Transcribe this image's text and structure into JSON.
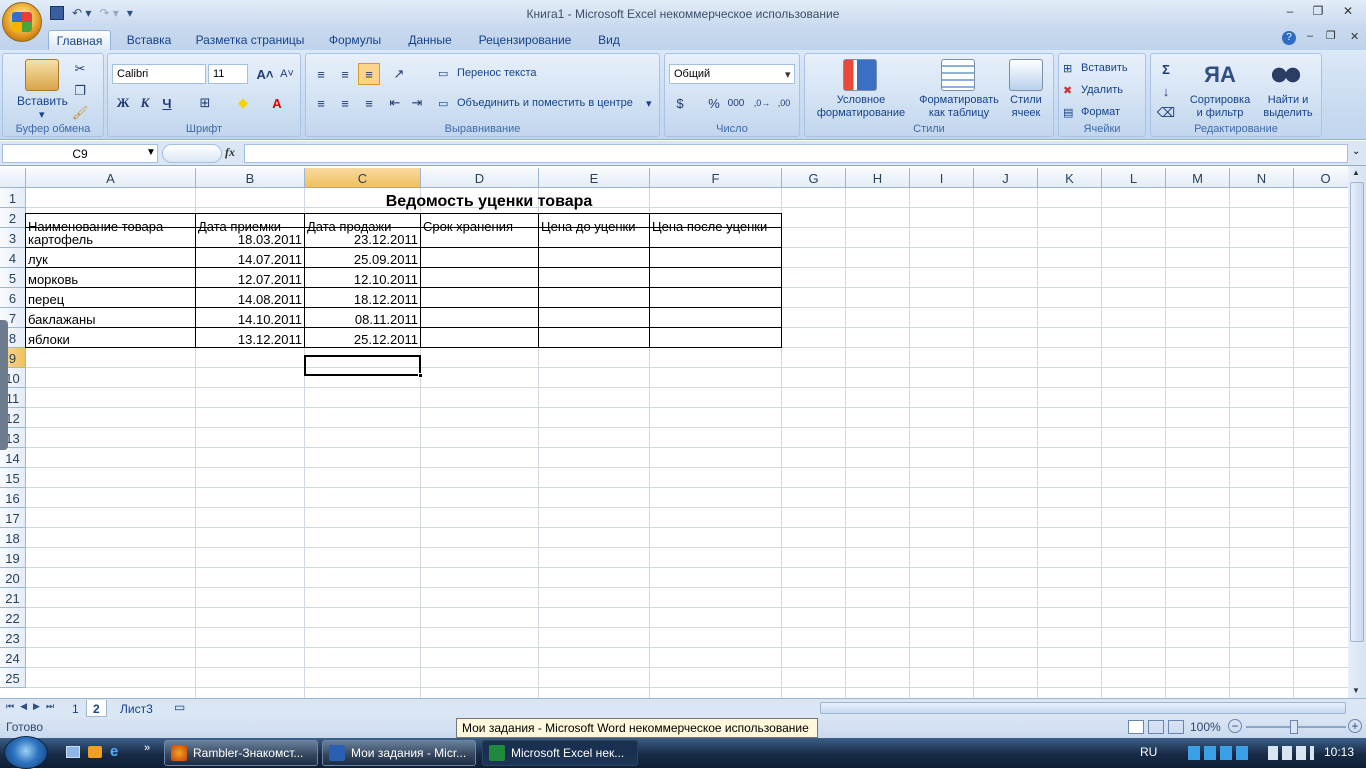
{
  "window": {
    "title": "Книга1  -  Microsoft Excel некоммерческое использование",
    "minimize": "–",
    "restore": "❐",
    "close": "✕"
  },
  "ribbon": {
    "tabs": [
      "Главная",
      "Вставка",
      "Разметка страницы",
      "Формулы",
      "Данные",
      "Рецензирование",
      "Вид"
    ],
    "active_tab": "Главная",
    "clipboard": {
      "paste": "Вставить",
      "group": "Буфер обмена"
    },
    "font": {
      "name": "Calibri",
      "size": "11",
      "group": "Шрифт",
      "bold": "Ж",
      "italic": "К",
      "underline": "Ч"
    },
    "alignment": {
      "wrap": "Перенос текста",
      "merge": "Объединить и поместить в центре",
      "group": "Выравнивание"
    },
    "number": {
      "format": "Общий",
      "percent": "%",
      "thousands": "000",
      "group": "Число"
    },
    "styles": {
      "conditional": "Условное\nформатирование",
      "table": "Форматировать\nкак таблицу",
      "cell": "Стили\nячеек",
      "group": "Стили"
    },
    "cells": {
      "insert": "Вставить",
      "delete": "Удалить",
      "format": "Формат",
      "group": "Ячейки"
    },
    "editing": {
      "sort": "Сортировка\nи фильтр",
      "find": "Найти и\nвыделить",
      "group": "Редактирование"
    }
  },
  "formula_bar": {
    "name_box": "C9",
    "fx": "fx",
    "value": ""
  },
  "sheet": {
    "columns": [
      "A",
      "B",
      "C",
      "D",
      "E",
      "F",
      "G",
      "H",
      "I",
      "J",
      "K",
      "L",
      "M",
      "N",
      "O"
    ],
    "rows": [
      "1",
      "2",
      "3",
      "4",
      "5",
      "6",
      "7",
      "8",
      "9",
      "10",
      "11",
      "12",
      "13",
      "14",
      "15",
      "16",
      "17",
      "18",
      "19",
      "20",
      "21",
      "22",
      "23",
      "24",
      "25"
    ],
    "selected_cell": "C9",
    "title": "Ведомость уценки товара",
    "headers": [
      "Наименование товара",
      "Дата приемки",
      "Дата продажи",
      "Срок хранения",
      "Цена до уценки",
      "Цена после уценки"
    ],
    "data": [
      [
        "картофель",
        "18.03.2011",
        "23.12.2011"
      ],
      [
        "лук",
        "14.07.2011",
        "25.09.2011"
      ],
      [
        "морковь",
        "12.07.2011",
        "12.10.2011"
      ],
      [
        "перец",
        "14.08.2011",
        "18.12.2011"
      ],
      [
        "баклажаны",
        "14.10.2011",
        "08.11.2011"
      ],
      [
        "яблоки",
        "13.12.2011",
        "25.12.2011"
      ]
    ]
  },
  "sheet_tabs": [
    "1",
    "2",
    "Лист3"
  ],
  "active_sheet": "2",
  "status": {
    "ready": "Готово",
    "zoom": "100%"
  },
  "tooltip": "Мои задания - Microsoft Word некоммерческое использование",
  "taskbar": {
    "items": [
      "Rambler-Знакомст...",
      "Мои задания - Micr...",
      "Microsoft Excel нек..."
    ],
    "language": "RU",
    "time": "10:13"
  },
  "colors": {
    "ribbon": "#c7daf0",
    "selected_header": "#f1c15f",
    "taskbar": "#172a45"
  }
}
